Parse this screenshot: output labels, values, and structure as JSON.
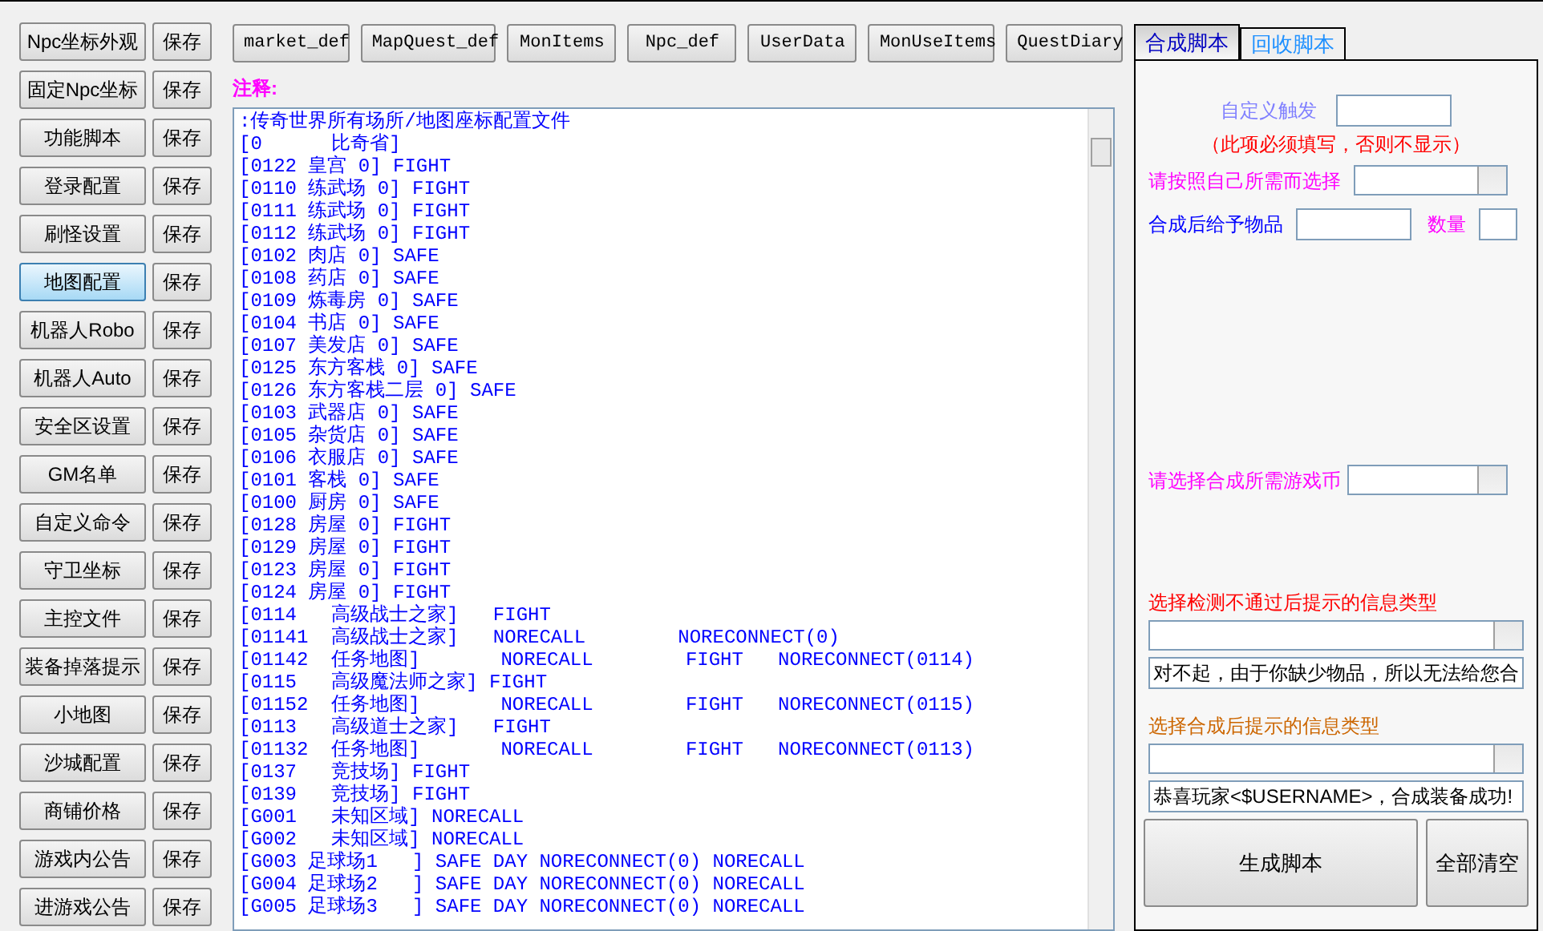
{
  "sidebar": {
    "items": [
      {
        "label": "Npc坐标外观",
        "selected": false,
        "save": "保存"
      },
      {
        "label": "固定Npc坐标",
        "selected": false,
        "save": "保存"
      },
      {
        "label": "功能脚本",
        "selected": false,
        "save": "保存"
      },
      {
        "label": "登录配置",
        "selected": false,
        "save": "保存"
      },
      {
        "label": "刷怪设置",
        "selected": false,
        "save": "保存"
      },
      {
        "label": "地图配置",
        "selected": true,
        "save": "保存"
      },
      {
        "label": "机器人Robo",
        "selected": false,
        "save": "保存"
      },
      {
        "label": "机器人Auto",
        "selected": false,
        "save": "保存"
      },
      {
        "label": "安全区设置",
        "selected": false,
        "save": "保存"
      },
      {
        "label": "GM名单",
        "selected": false,
        "save": "保存"
      },
      {
        "label": "自定义命令",
        "selected": false,
        "save": "保存"
      },
      {
        "label": "守卫坐标",
        "selected": false,
        "save": "保存"
      },
      {
        "label": "主控文件",
        "selected": false,
        "save": "保存"
      },
      {
        "label": "装备掉落提示",
        "selected": false,
        "save": "保存"
      },
      {
        "label": "小地图",
        "selected": false,
        "save": "保存"
      },
      {
        "label": "沙城配置",
        "selected": false,
        "save": "保存"
      },
      {
        "label": "商铺价格",
        "selected": false,
        "save": "保存"
      },
      {
        "label": "游戏内公告",
        "selected": false,
        "save": "保存"
      },
      {
        "label": "进游戏公告",
        "selected": false,
        "save": "保存"
      }
    ]
  },
  "toolbar": [
    "market_def",
    "MapQuest_def",
    "MonItems",
    "Npc_def",
    "UserData",
    "MonUseItems",
    "QuestDiary"
  ],
  "note_label": "注释:",
  "editor": {
    "lines": [
      ":传奇世界所有场所/地图座标配置文件",
      "[0      比奇省]",
      "[0122 皇宫 0] FIGHT",
      "[0110 练武场 0] FIGHT",
      "[0111 练武场 0] FIGHT",
      "[0112 练武场 0] FIGHT",
      "[0102 肉店 0] SAFE",
      "[0108 药店 0] SAFE",
      "[0109 炼毒房 0] SAFE",
      "[0104 书店 0] SAFE",
      "[0107 美发店 0] SAFE",
      "[0125 东方客栈 0] SAFE",
      "[0126 东方客栈二层 0] SAFE",
      "[0103 武器店 0] SAFE",
      "[0105 杂货店 0] SAFE",
      "[0106 衣服店 0] SAFE",
      "[0101 客栈 0] SAFE",
      "[0100 厨房 0] SAFE",
      "[0128 房屋 0] FIGHT",
      "[0129 房屋 0] FIGHT",
      "[0123 房屋 0] FIGHT",
      "[0124 房屋 0] FIGHT",
      "[0114   高级战士之家]   FIGHT",
      "[01141  高级战士之家]   NORECALL        NORECONNECT(0)",
      "[01142  任务地图]       NORECALL        FIGHT   NORECONNECT(0114)",
      "[0115   高级魔法师之家] FIGHT",
      "[01152  任务地图]       NORECALL        FIGHT   NORECONNECT(0115)",
      "[0113   高级道士之家]   FIGHT",
      "[01132  任务地图]       NORECALL        FIGHT   NORECONNECT(0113)",
      "[0137   竞技场] FIGHT",
      "[0139   竞技场] FIGHT",
      "[G001   未知区域] NORECALL",
      "[G002   未知区域] NORECALL",
      "[G003 足球场1   ] SAFE DAY NORECONNECT(0) NORECALL",
      "[G004 足球场2   ] SAFE DAY NORECONNECT(0) NORECALL",
      "[G005 足球场3   ] SAFE DAY NORECONNECT(0) NORECALL"
    ]
  },
  "panel": {
    "tabs": [
      {
        "label": "合成脚本",
        "selected": true
      },
      {
        "label": "回收脚本",
        "selected": false
      }
    ],
    "trigger_label": "自定义触发",
    "required_note": "（此项必须填写，否则不显示）",
    "choose_label": "请按照自己所需而选择",
    "give_label": "合成后给予物品",
    "qty_label": "数量",
    "coin_label": "请选择合成所需游戏币",
    "fail_label": "选择检测不通过后提示的信息类型",
    "fail_message": "对不起，由于你缺少物品，所以无法给您合",
    "success_label": "选择合成后提示的信息类型",
    "success_message": "恭喜玩家<$USERNAME>，合成装备成功!",
    "buttons": [
      "生成脚本",
      "全部清空"
    ]
  }
}
